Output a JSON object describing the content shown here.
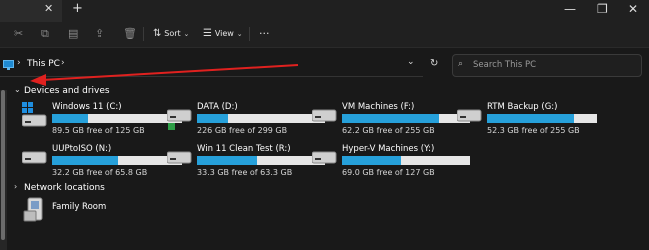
{
  "titlebar": {
    "close_tab": "✕",
    "new_tab": "+",
    "minimize": "—",
    "maximize": "❐",
    "close": "✕"
  },
  "toolbar": {
    "sort_label": "Sort",
    "view_label": "View",
    "more_label": "···"
  },
  "address": {
    "location": "This PC",
    "search_placeholder": "Search This PC"
  },
  "devices": {
    "title": "Devices and drives",
    "drives": [
      {
        "name": "Windows 11 (C:)",
        "free": "89.5 GB free of 125 GB",
        "used_fraction": 0.28
      },
      {
        "name": "DATA (D:)",
        "free": "226 GB free of 299 GB",
        "used_fraction": 0.24
      },
      {
        "name": "VM Machines (F:)",
        "free": "62.2 GB free of 255 GB",
        "used_fraction": 0.76
      },
      {
        "name": "RTM Backup (G:)",
        "free": "52.3 GB free of 255 GB",
        "used_fraction": 0.79
      },
      {
        "name": "UUPtoISO (N:)",
        "free": "32.2 GB free of 65.8 GB",
        "used_fraction": 0.51
      },
      {
        "name": "Win 11 Clean Test (R:)",
        "free": "33.3 GB free of 63.3 GB",
        "used_fraction": 0.47
      },
      {
        "name": "Hyper-V Machines (Y:)",
        "free": "69.0 GB free of 127 GB",
        "used_fraction": 0.46
      }
    ]
  },
  "network": {
    "title": "Network locations",
    "items": [
      {
        "name": "Family Room"
      }
    ]
  },
  "colors": {
    "accent": "#26a0da",
    "annotation_arrow": "#e0211f"
  }
}
